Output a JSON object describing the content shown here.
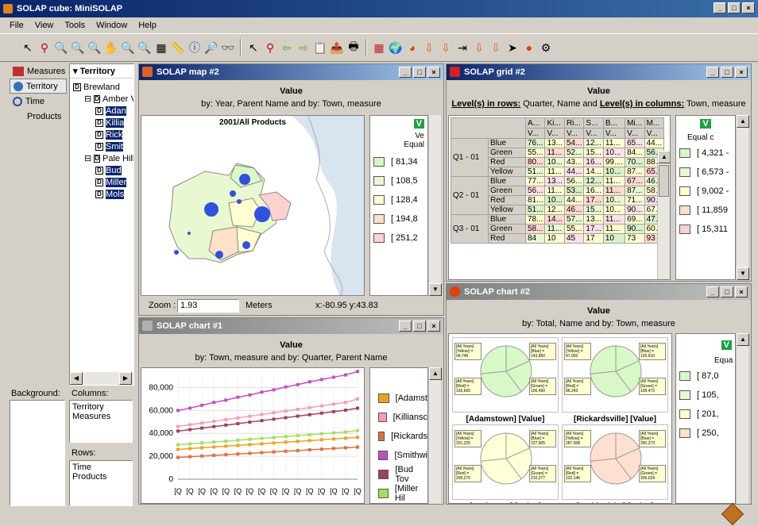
{
  "app": {
    "title": "SOLAP cube: MiniSOLAP"
  },
  "menu": [
    "File",
    "View",
    "Tools",
    "Window",
    "Help"
  ],
  "sidebar": {
    "items": [
      {
        "label": "Measures"
      },
      {
        "label": "Territory"
      },
      {
        "label": "Time"
      },
      {
        "label": "Products"
      }
    ]
  },
  "tree": {
    "header": "Territory",
    "nodes": [
      {
        "label": "Brewland",
        "level": 0,
        "sel": false
      },
      {
        "label": "Amber V",
        "level": 1,
        "sel": false
      },
      {
        "label": "Adan",
        "level": 2,
        "sel": true
      },
      {
        "label": "Killia",
        "level": 2,
        "sel": true
      },
      {
        "label": "Rick",
        "level": 2,
        "sel": true
      },
      {
        "label": "Smit",
        "level": 2,
        "sel": true
      },
      {
        "label": "Pale Hills",
        "level": 1,
        "sel": false
      },
      {
        "label": "Bud",
        "level": 2,
        "sel": true
      },
      {
        "label": "Miller",
        "level": 2,
        "sel": true
      },
      {
        "label": "Mols",
        "level": 2,
        "sel": true
      }
    ]
  },
  "bottom": {
    "background_label": "Background:",
    "columns_label": "Columns:",
    "columns": [
      "Territory",
      "Measures"
    ],
    "rows_label": "Rows:",
    "rows": [
      "Time",
      "Products"
    ]
  },
  "map": {
    "title": "SOLAP map #2",
    "h1": "Value",
    "h2": "by: Year, Parent Name and by: Town, measure",
    "map_title": "2001/All Products",
    "legend_v": "V",
    "legend_t1": "Ve",
    "legend_t2": "Equal",
    "legend": [
      {
        "label": "[ 81,34",
        "color": "#d8f8c8"
      },
      {
        "label": "[ 108,5",
        "color": "#e8f8d0"
      },
      {
        "label": "[ 128,4",
        "color": "#ffffd0"
      },
      {
        "label": "[ 194,8",
        "color": "#ffe0c8"
      },
      {
        "label": "[ 251,2",
        "color": "#ffd0d0"
      }
    ],
    "zoom_label": "Zoom :",
    "zoom": "1.93",
    "unit": "Meters",
    "coords": "x:-80.95  y:43.83"
  },
  "grid": {
    "title": "SOLAP grid #2",
    "h1": "Value",
    "h2a": "Level(s) in rows:",
    "h2b": " Quarter, Name and ",
    "h2c": "Level(s) in columns:",
    "h2d": " Town, measure",
    "cols": [
      "A...",
      "Ki...",
      "Ri...",
      "S...",
      "B...",
      "Mi...",
      "M..."
    ],
    "sub": [
      "V...",
      "V...",
      "V...",
      "V...",
      "V...",
      "V...",
      "V..."
    ],
    "rows": [
      {
        "q": "Q1 - 01",
        "name": "Blue",
        "v": [
          "76...",
          "13...",
          "54...",
          "12...",
          "11...",
          "65...",
          "44..."
        ]
      },
      {
        "q": "",
        "name": "Green",
        "v": [
          "55...",
          "11...",
          "52...",
          "15...",
          "10...",
          "84...",
          "56..."
        ]
      },
      {
        "q": "",
        "name": "Red",
        "v": [
          "80...",
          "10...",
          "43...",
          "16...",
          "99....",
          "70...",
          "88..."
        ]
      },
      {
        "q": "",
        "name": "Yellow",
        "v": [
          "51...",
          "11...",
          "44...",
          "14...",
          "10...",
          "87...",
          "65..."
        ]
      },
      {
        "q": "Q2 - 01",
        "name": "Blue",
        "v": [
          "77...",
          "13...",
          "56...",
          "12...",
          "11...",
          "67...",
          "46..."
        ]
      },
      {
        "q": "",
        "name": "Green",
        "v": [
          "56...",
          "11...",
          "53...",
          "16...",
          "11...",
          "87...",
          "58..."
        ]
      },
      {
        "q": "",
        "name": "Red",
        "v": [
          "81...",
          "10...",
          "44...",
          "17...",
          "10...",
          "71...",
          "90..."
        ]
      },
      {
        "q": "",
        "name": "Yellow",
        "v": [
          "51...",
          "12...",
          "46...",
          "15...",
          "10...",
          "90...",
          "67..."
        ]
      },
      {
        "q": "Q3 - 01",
        "name": "Blue",
        "v": [
          "78...",
          "14...",
          "57...",
          "13...",
          "11...",
          "69...",
          "47..."
        ]
      },
      {
        "q": "",
        "name": "Green",
        "v": [
          "58...",
          "11...",
          "55...",
          "17...",
          "11...",
          "90...",
          "60..."
        ]
      },
      {
        "q": "",
        "name": "Red",
        "v": [
          "84",
          "10",
          "45",
          "17",
          "10",
          "73",
          "93"
        ]
      }
    ],
    "legend_v": "V",
    "legend_t": "Equal c",
    "legend": [
      {
        "label": "[ 4,321 -",
        "color": "#d8f8c8"
      },
      {
        "label": "[ 6,573 -",
        "color": "#e8f8d0"
      },
      {
        "label": "[ 9,002 -",
        "color": "#ffffd0"
      },
      {
        "label": "[ 11,859",
        "color": "#ffe0c8"
      },
      {
        "label": "[ 15,311",
        "color": "#ffd0d0"
      }
    ]
  },
  "chart1": {
    "title": "SOLAP chart #1",
    "h1": "Value",
    "h2": "by: Town, measure and by: Quarter, Parent Name",
    "legend": [
      {
        "label": "[Adamst",
        "color": "#f0a020"
      },
      {
        "label": "[Killiansc",
        "color": "#f0a0b0"
      },
      {
        "label": "[Rickards",
        "color": "#e07040"
      },
      {
        "label": "[Smithwi",
        "color": "#c050c0"
      },
      {
        "label": "[Bud Tov",
        "color": "#a04060"
      },
      {
        "label": "[Miller Hil",
        "color": "#a0e060"
      }
    ]
  },
  "chart2": {
    "title": "SOLAP chart #2",
    "h1": "Value",
    "h2": "by: Total, Name and by: Town, measure",
    "pies": [
      {
        "label": "[Adamstown]  [Value]",
        "color": "#d8f8c8",
        "b1": "[All Years] [Yellow] = 94,745",
        "b2": "[All Years] [Blue] = 143,850",
        "b3": "[All Years] [Red] = 155,665",
        "b4": "[All Years] [Green] = 106,490"
      },
      {
        "label": "[Rickardsville]  [Value]",
        "color": "#d8f8c8",
        "b1": "[All Years] [Yellow] = 87,050",
        "b2": "[All Years] [Blue] = 105,610",
        "b3": "[All Years] [Red] = 86,243",
        "b4": "[All Years] [Green] = 105,473"
      },
      {
        "label": "[Bud Town]  [Value]",
        "color": "#ffffd8",
        "b1": "[All Years] [Yellow] = 201,225",
        "b2": "[All Years] [Blue] = 227,905",
        "b3": "[All Years] [Red] = 209,270",
        "b4": "[All Years] [Green] = 210,277"
      },
      {
        "label": "[Smithwicks]  [Value]",
        "color": "#ffe0d0",
        "b1": "[All Years] [Yellow] = 287,008",
        "b2": "[All Years] [Blue] = 250,273",
        "b3": "[All Years] [Red] = 232,146",
        "b4": "[All Years] [Green] = 336,024"
      }
    ],
    "legend_v": "V",
    "legend_t": "Equa",
    "legend": [
      {
        "label": "[ 87,0",
        "color": "#d8f8c8"
      },
      {
        "label": "[ 105,",
        "color": "#e8f8d0"
      },
      {
        "label": "[ 201,",
        "color": "#ffffd0"
      },
      {
        "label": "[ 250,",
        "color": "#ffe0c8"
      }
    ]
  },
  "chart_data": {
    "type": "line",
    "title": "",
    "xlabel": "",
    "ylabel": "",
    "ylim": [
      0,
      90000
    ],
    "yticks": [
      "80,000",
      "60,000",
      "40,000",
      "20,000",
      "0"
    ],
    "x": [
      "[Q",
      "[Q",
      "[Q",
      "[Q",
      "[Q",
      "[Q",
      "[Q",
      "[Q",
      "[Q",
      "[Q",
      "[Q",
      "[Q",
      "[Q",
      "[Q",
      "[Q",
      "[Q"
    ],
    "series": [
      {
        "color": "#c050c0",
        "values": [
          60000,
          62000,
          64500,
          67000,
          69000,
          71500,
          73500,
          76000,
          78000,
          80500,
          82500,
          85000,
          87000,
          89000,
          91000,
          94000
        ]
      },
      {
        "color": "#f0a0b0",
        "values": [
          46000,
          47500,
          49000,
          50500,
          52000,
          53500,
          55000,
          56500,
          58000,
          59500,
          61000,
          62500,
          64000,
          65500,
          67000,
          70000
        ]
      },
      {
        "color": "#a04060",
        "values": [
          42000,
          43300,
          44600,
          45900,
          47200,
          48500,
          49800,
          51100,
          52400,
          53700,
          55000,
          56300,
          57600,
          58900,
          60200,
          62000
        ]
      },
      {
        "color": "#a0e060",
        "values": [
          30000,
          30800,
          31600,
          32400,
          33200,
          34000,
          34800,
          35600,
          36400,
          37200,
          38000,
          38800,
          39600,
          40400,
          41200,
          42500
        ]
      },
      {
        "color": "#f0a020",
        "values": [
          26000,
          26700,
          27400,
          28100,
          28800,
          29500,
          30200,
          30900,
          31600,
          32300,
          33000,
          33700,
          34400,
          35100,
          35800,
          36500
        ]
      },
      {
        "color": "#e07040",
        "values": [
          19000,
          19600,
          20200,
          20800,
          21400,
          22000,
          22600,
          23200,
          23800,
          24400,
          25000,
          25600,
          26200,
          26800,
          27400,
          28000
        ]
      }
    ]
  }
}
